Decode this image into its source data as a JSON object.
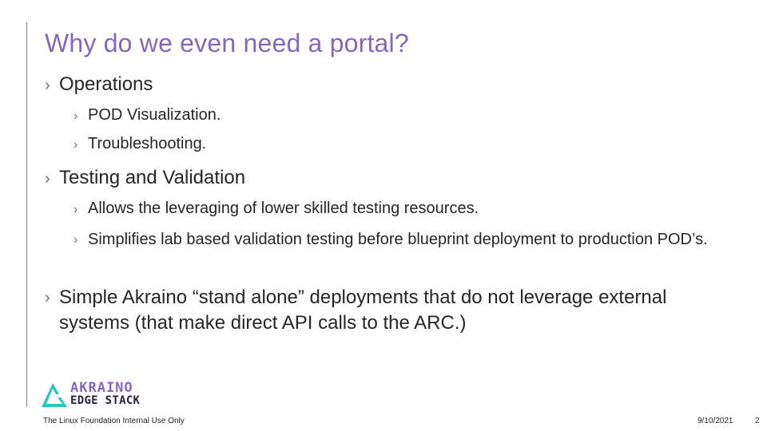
{
  "slide": {
    "title": "Why do we even need a portal?",
    "bullets": [
      {
        "text": "Operations",
        "children": [
          {
            "text": "POD Visualization."
          },
          {
            "text": "Troubleshooting."
          }
        ]
      },
      {
        "text": "Testing and Validation",
        "children": [
          {
            "text": "Allows the leveraging of lower skilled testing resources."
          },
          {
            "text": "Simplifies lab based validation testing before blueprint deployment to production POD’s."
          }
        ]
      },
      {
        "text": "Simple Akraino “stand alone” deployments that do not leverage external systems (that make direct API calls to the ARC.)",
        "children": []
      }
    ],
    "bullet_glyph": "›"
  },
  "logo": {
    "line1": "AKRAINO",
    "line2": "EDGE STACK",
    "colors": {
      "mark": "#2bc4bd",
      "line1": "#8a66c1",
      "line2": "#2c2240"
    }
  },
  "footer": {
    "left": "The Linux Foundation Internal Use Only",
    "date": "9/10/2021",
    "page": "2"
  },
  "colors": {
    "title": "#8767b8",
    "text": "#262626",
    "bullet": "#7a5fa3",
    "rule": "#8a7a96"
  }
}
